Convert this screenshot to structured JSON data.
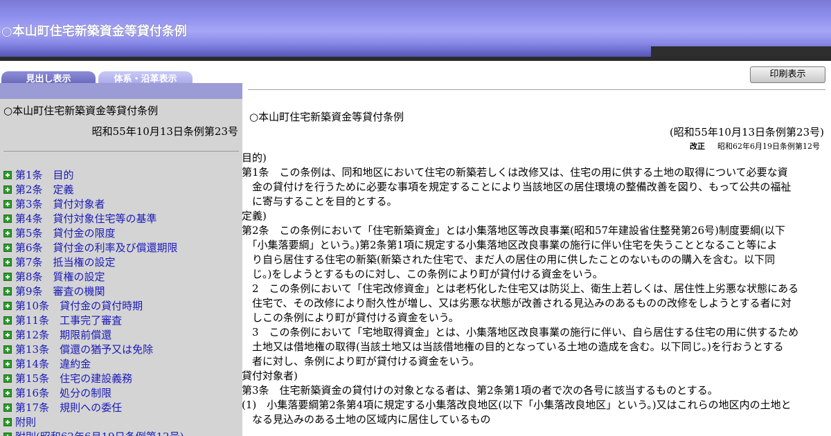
{
  "header": {
    "title": "○本山町住宅新築資金等貸付条例"
  },
  "tabs": [
    {
      "label": "見出し表示"
    },
    {
      "label": "体系・沿革表示"
    }
  ],
  "left": {
    "doc_title": "○本山町住宅新築資金等貸付条例",
    "doc_date": "昭和55年10月13日条例第23号",
    "toc": [
      "第1条　目的",
      "第2条　定義",
      "第3条　貸付対象者",
      "第4条　貸付対象住宅等の基準",
      "第5条　貸付金の限度",
      "第6条　貸付金の利率及び償還期限",
      "第7条　抵当権の設定",
      "第8条　質権の設定",
      "第9条　審査の機関",
      "第10条　貸付金の貸付時期",
      "第11条　工事完了審査",
      "第12条　期限前償還",
      "第13条　償還の猶予又は免除",
      "第14条　違約金",
      "第15条　住宅の建設義務",
      "第16条　処分の制限",
      "第17条　規則への委任",
      "附則",
      "附則(昭和62年6月19日条例第12号)"
    ]
  },
  "right": {
    "print_label": "印刷表示",
    "title": "○本山町住宅新築資金等貸付条例",
    "date": "(昭和55年10月13日条例第23号)",
    "revision_label": "改正",
    "revision_text": "昭和62年6月19日条例第12号",
    "lines": [
      "目的)",
      "第1条　この条例は、同和地区において住宅の新築若しくは改修又は、住宅の用に供する土地の取得について必要な資",
      "　金の貸付けを行うために必要な事項を規定することにより当該地区の居住環境の整備改善を図り、もって公共の福祉",
      "　に寄与することを目的とする。",
      "定義)",
      "第2条　この条例において「住宅新築資金」とは小集落地区等改良事業(昭和57年建設省住整発第26号)制度要綱(以下",
      "　「小集落要綱」という。)第2条第1項に規定する小集落地区改良事業の施行に伴い住宅を失うこととなること等によ",
      "　り自ら居住する住宅の新築(新築された住宅で、まだ人の居住の用に供したことのないものの購入を含む。以下同",
      "　じ。)をしようとするものに対し、この条例により町が貸付ける資金をいう。",
      "　2　この条例において「住宅改修資金」とは老朽化した住宅又は防災上、衛生上若しくは、居住性上劣悪な状態にある",
      "　住宅で、その改修により耐久性が増し、又は劣悪な状態が改善される見込みのあるものの改修をしようとする者に対",
      "　しこの条例により町が貸付ける資金をいう。",
      "　3　この条例において「宅地取得資金」とは、小集落地区改良事業の施行に伴い、自ら居住する住宅の用に供するため",
      "　土地又は借地権の取得(当該土地又は当該借地権の目的となっている土地の造成を含む。以下同じ。)を行おうとする",
      "　者に対し、条例により町が貸付ける資金をいう。",
      "貸付対象者)",
      "第3条　住宅新築資金の貸付けの対象となる者は、第2条第1項の者で次の各号に該当するものとする。",
      "(1)　小集落要綱第2条第4項に規定する小集落改良地区(以下「小集落改良地区」という。)又はこれらの地区内の土地と",
      "　なる見込みのある土地の区域内に居住しているもの"
    ]
  }
}
